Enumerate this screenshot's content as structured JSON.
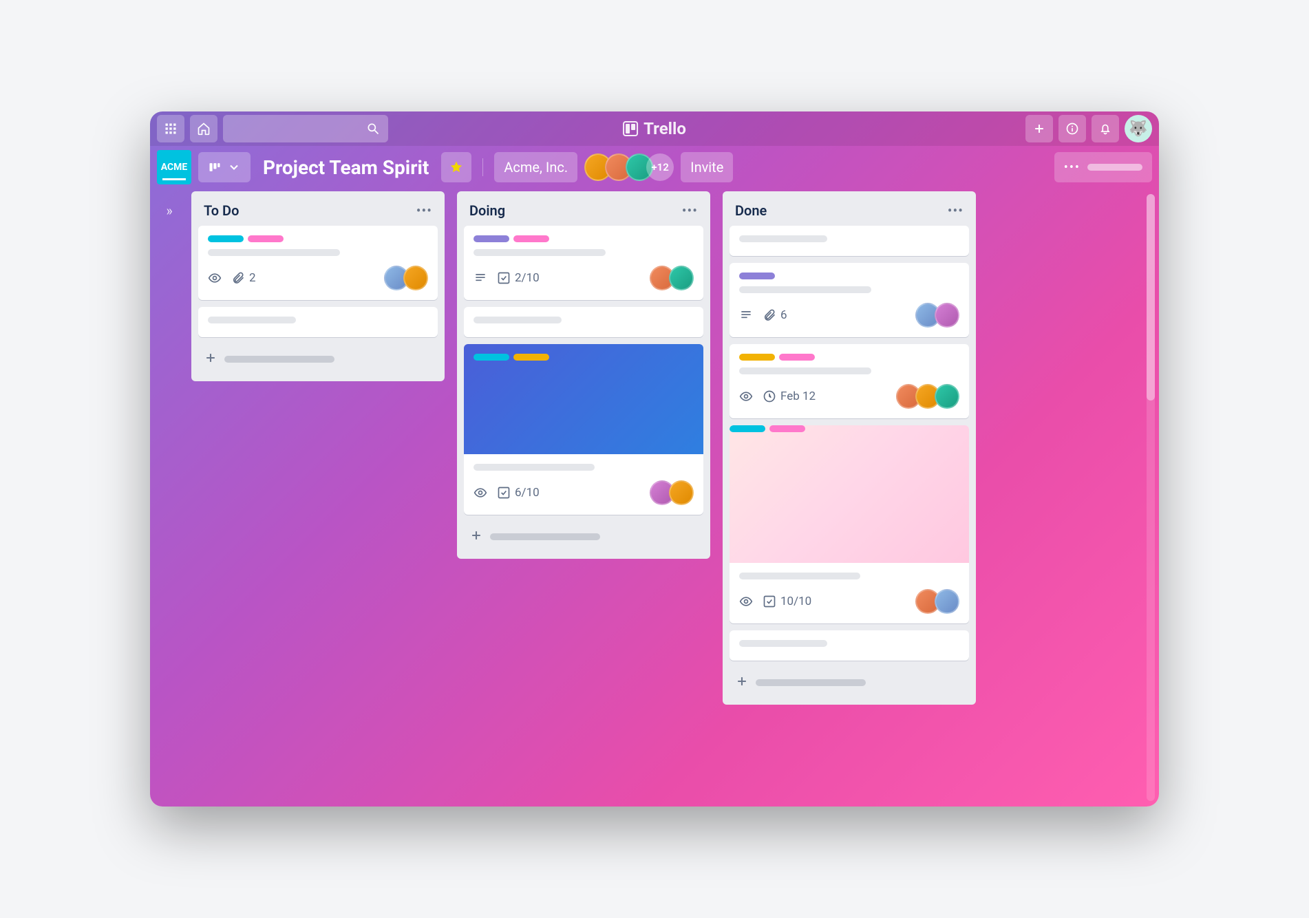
{
  "app": {
    "name": "Trello"
  },
  "boardbar": {
    "team_badge": "ACME",
    "board_title": "Project Team Spirit",
    "workspace": "Acme, Inc.",
    "extra_members": "+12",
    "invite": "Invite"
  },
  "colors": {
    "cyan": "#00c2e0",
    "pink": "#ff78cb",
    "purple": "#8d80d8",
    "yellow": "#f2b203"
  },
  "lists": [
    {
      "title": "To Do",
      "cards": [
        {
          "labels": [
            "cyan",
            "pink"
          ],
          "badges": {
            "watch": true,
            "attachments": "2"
          },
          "members": [
            "av-1",
            "av-2"
          ]
        },
        {
          "placeholder_only": true
        }
      ]
    },
    {
      "title": "Doing",
      "cards": [
        {
          "labels": [
            "purple",
            "pink"
          ],
          "badges": {
            "description": true,
            "checklist": "2/10"
          },
          "members": [
            "av-5",
            "av-3"
          ]
        },
        {
          "placeholder_only": true
        },
        {
          "cover": "blue",
          "cover_labels": [
            "cyan",
            "yellow"
          ],
          "badges": {
            "watch": true,
            "checklist": "6/10"
          },
          "members": [
            "av-4",
            "av-2"
          ]
        }
      ]
    },
    {
      "title": "Done",
      "cards": [
        {
          "placeholder_only": true
        },
        {
          "labels": [
            "purple"
          ],
          "badges": {
            "description": true,
            "attachments": "6"
          },
          "members": [
            "av-1",
            "av-4"
          ]
        },
        {
          "labels": [
            "yellow",
            "pink"
          ],
          "badges": {
            "watch": true,
            "due": "Feb 12"
          },
          "members": [
            "av-5",
            "av-2",
            "av-3"
          ]
        },
        {
          "cover": "pink",
          "cover_labels": [
            "cyan",
            "pink"
          ],
          "badges": {
            "watch": true,
            "checklist": "10/10"
          },
          "members": [
            "av-5",
            "av-1"
          ]
        },
        {
          "placeholder_only": true
        }
      ]
    }
  ]
}
